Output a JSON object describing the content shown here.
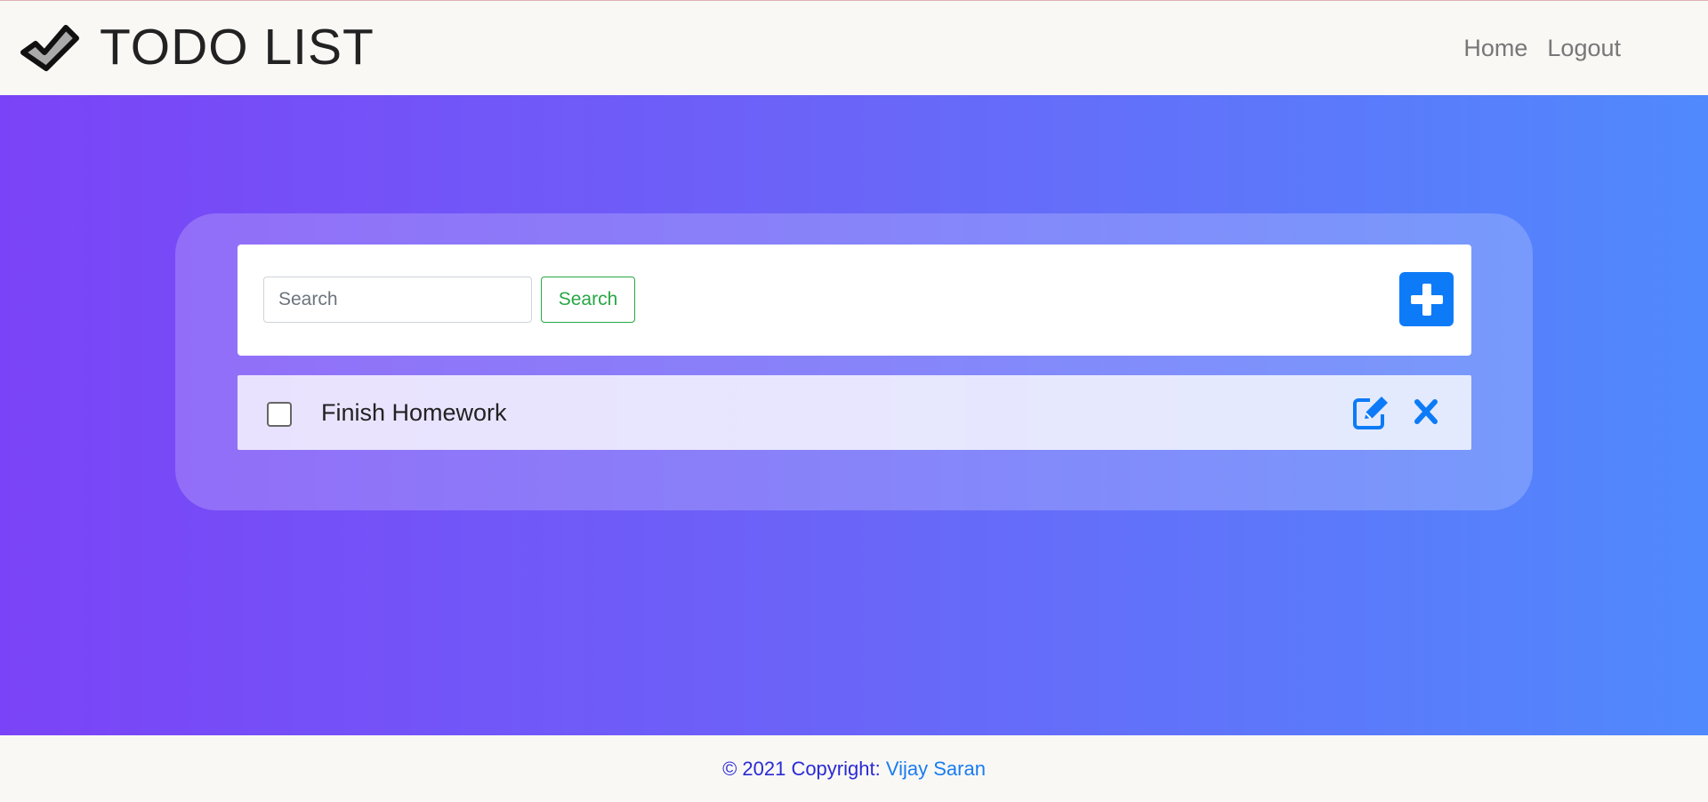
{
  "navbar": {
    "brand": "TODO LIST",
    "brand_icon": "checkmark-icon",
    "links": [
      "Home",
      "Logout"
    ]
  },
  "search": {
    "placeholder": "Search",
    "value": "",
    "button_label": "Search"
  },
  "add_button_icon": "plus-icon",
  "todos": [
    {
      "text": "Finish Homework",
      "checked": false
    }
  ],
  "footer": {
    "copyright": "© 2021 Copyright: ",
    "author": "Vijay Saran"
  },
  "colors": {
    "gradient_start": "#7b43f7",
    "gradient_end": "#5089fd",
    "primary": "#0d7bf7",
    "success": "#28a745"
  }
}
